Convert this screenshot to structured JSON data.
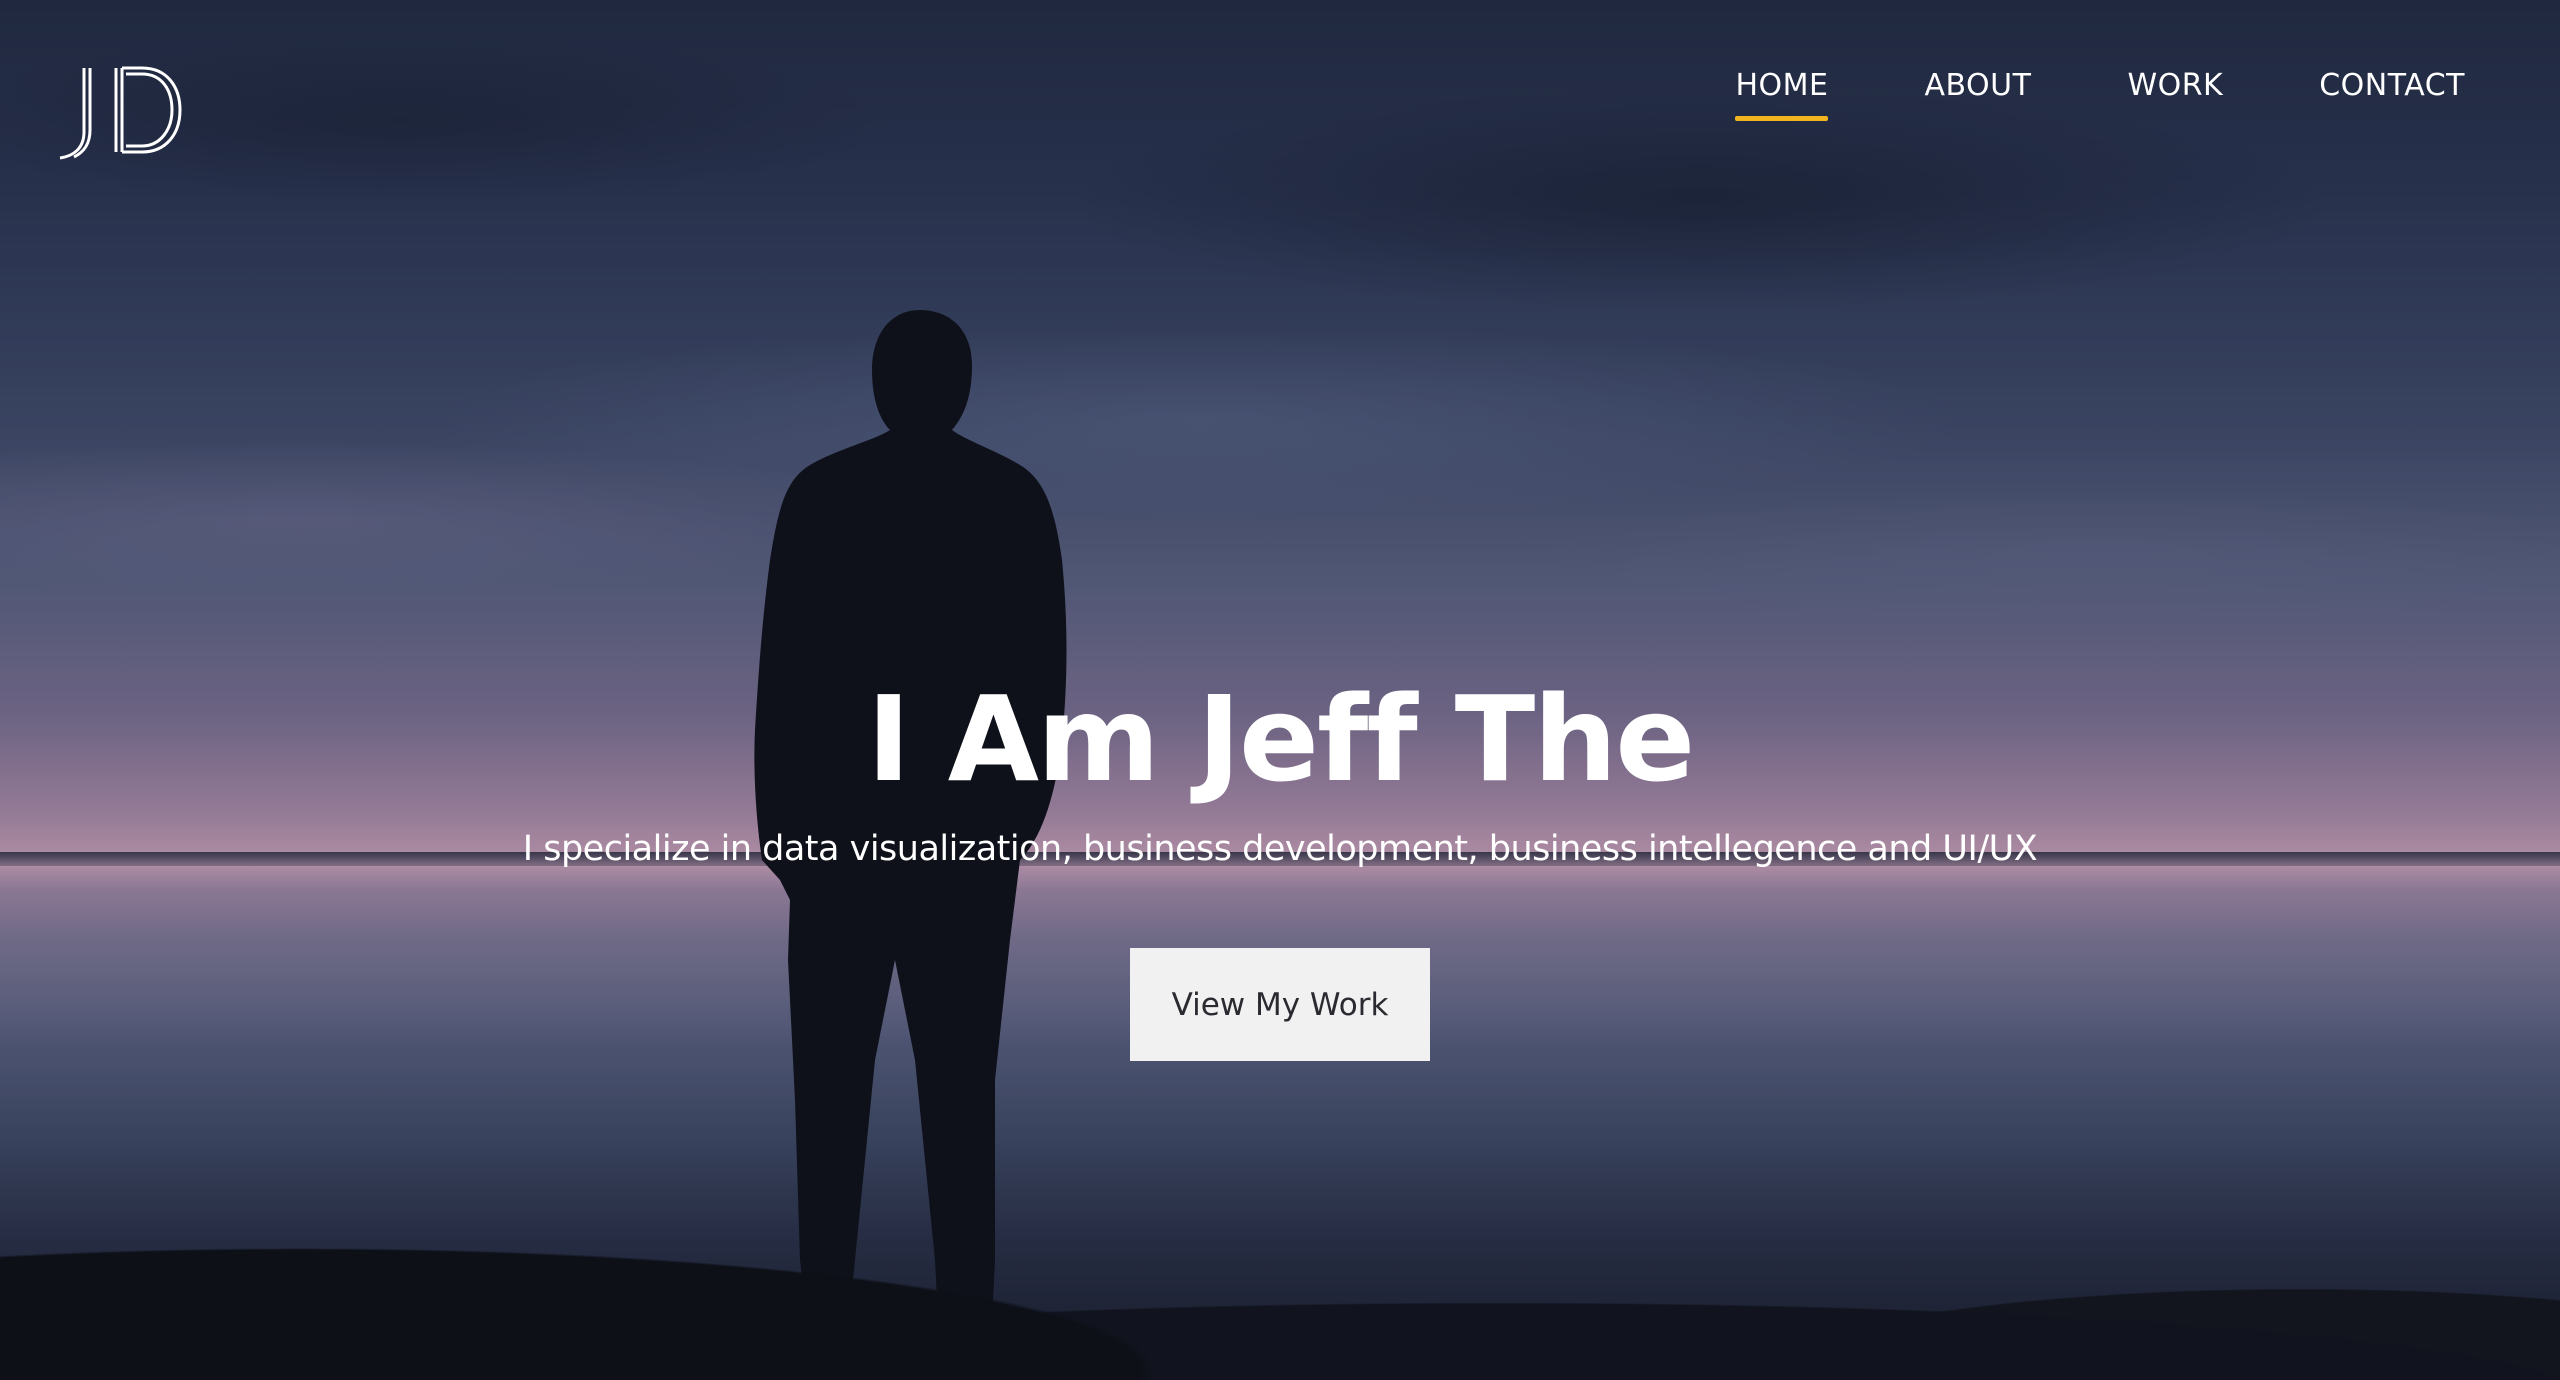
{
  "logo": {
    "text": "JD",
    "icon": "jd-monogram-logo"
  },
  "nav": {
    "items": [
      {
        "label": "HOME",
        "active": true
      },
      {
        "label": "ABOUT",
        "active": false
      },
      {
        "label": "WORK",
        "active": false
      },
      {
        "label": "CONTACT",
        "active": false
      }
    ],
    "active_indicator_color": "#f2b51f"
  },
  "hero": {
    "headline": "I Am Jeff The",
    "subline": "I specialize in data visualization, business development, business intellegence and UI/UX",
    "cta_label": "View My Work"
  },
  "colors": {
    "text": "#ffffff",
    "button_bg": "#f1f1f2",
    "button_text": "#2a2a30"
  }
}
